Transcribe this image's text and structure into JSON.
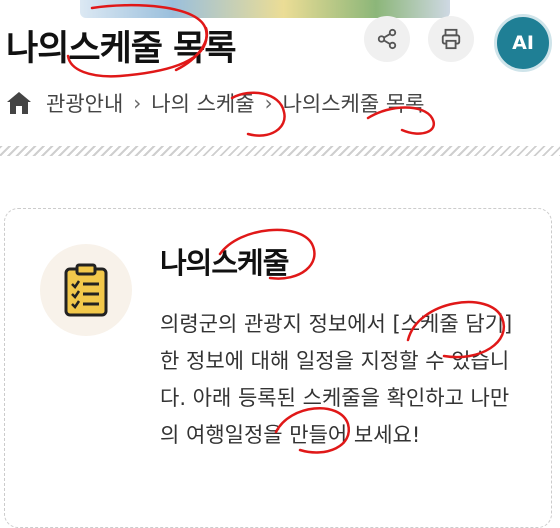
{
  "header": {
    "title": "나의스케줄 목록",
    "share_icon": "share-icon",
    "print_icon": "print-icon",
    "ai_label": "AI"
  },
  "breadcrumb": {
    "items": [
      "관광안내",
      "나의 스케줄",
      "나의스케줄 목록"
    ]
  },
  "card": {
    "title": "나의스케줄",
    "icon": "clipboard-checklist-icon",
    "description": "의령군의 관광지 정보에서 [스케줄 담기]한 정보에 대해 일정을 지정할 수 있습니다. 아래 등록된 스케줄을 확인하고 나만의 여행일정을 만들어 보세요!"
  },
  "colors": {
    "ai_button": "#1f7f95",
    "annotation_red": "#e01818",
    "icon_bg": "#f8f2ea",
    "clipboard": "#f2c84b"
  }
}
